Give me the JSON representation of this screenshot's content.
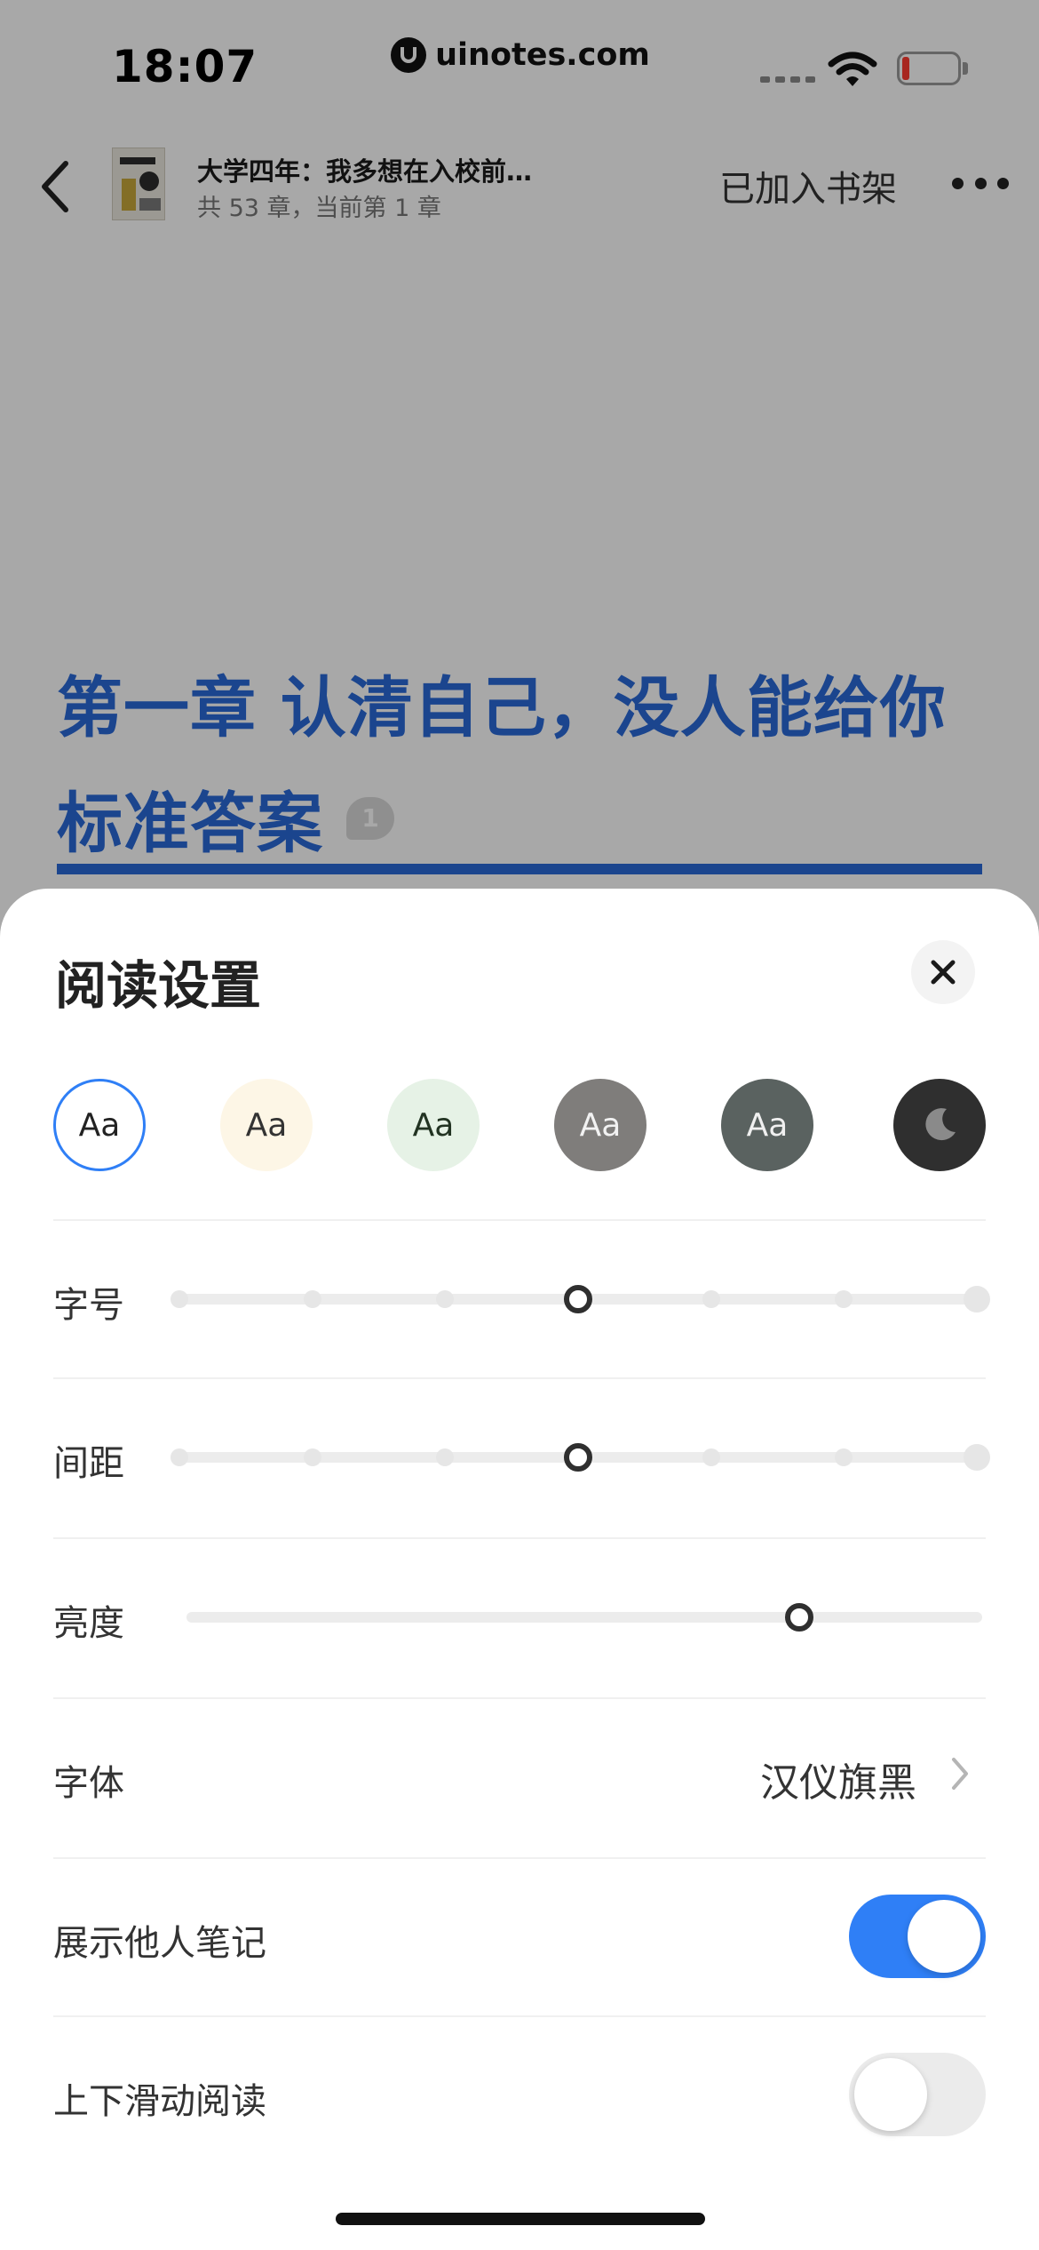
{
  "status_bar": {
    "time": "18:07",
    "watermark": "uinotes.com",
    "wifi_icon": "wifi-icon",
    "battery_icon": "battery-low-icon",
    "battery_color": "#ff3b30"
  },
  "nav": {
    "back_icon": "chevron-left-icon",
    "book_title": "大学四年：我多想在入校前…",
    "book_subtitle": "共 53 章，当前第 1 章",
    "shelf_status": "已加入书架",
    "more_icon": "more-icon"
  },
  "chapter": {
    "title_line1": "第一章 认清自己，没人能给你",
    "title_line2": "标准答案",
    "note_count": "1",
    "accent_color": "#2a6ad8"
  },
  "settings": {
    "title": "阅读设置",
    "close_icon": "close-icon",
    "themes": [
      {
        "label": "Aa",
        "bg": "#ffffff",
        "fg": "#222222",
        "selected": true
      },
      {
        "label": "Aa",
        "bg": "#fdf6e6",
        "fg": "#333333",
        "selected": false
      },
      {
        "label": "Aa",
        "bg": "#e6f2e6",
        "fg": "#223322",
        "selected": false
      },
      {
        "label": "Aa",
        "bg": "#7f7d7b",
        "fg": "#f2f2f2",
        "selected": false
      },
      {
        "label": "Aa",
        "bg": "#5a6260",
        "fg": "#f0f0f0",
        "selected": false
      },
      {
        "label": "",
        "bg": "#2f2f2f",
        "fg": "#8a8a8a",
        "selected": false,
        "icon": "moon-icon"
      }
    ],
    "font_size": {
      "label": "字号",
      "steps": 7,
      "selected_index": 3
    },
    "spacing": {
      "label": "间距",
      "steps": 7,
      "selected_index": 3
    },
    "brightness": {
      "label": "亮度",
      "level": 0.77
    },
    "font": {
      "label": "字体",
      "value": "汉仪旗黑"
    },
    "show_notes": {
      "label": "展示他人笔记",
      "on": true
    },
    "vertical_scroll": {
      "label": "上下滑动阅读",
      "on": false
    },
    "toggle_on_color": "#2f7ff6",
    "selected_ring_color": "#2f7ff6"
  }
}
